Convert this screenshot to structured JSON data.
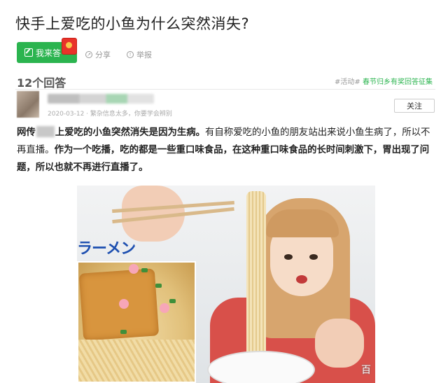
{
  "question": {
    "title": "快手上爱吃的小鱼为什么突然消失?"
  },
  "actions": {
    "answer_label": "我来答",
    "share_label": "分享",
    "report_label": "举报"
  },
  "answers": {
    "count_label": "12个回答",
    "tags": {
      "prefix": "#活动#",
      "highlight": "春节归乡有奖回答征集"
    }
  },
  "answer": {
    "meta": "2020-03-12 · 繁杂信息太多，你要学会辨别",
    "follow_label": "关注",
    "text": {
      "p1": "网传",
      "p2": "上爱吃的小鱼突然消失是因为生病。",
      "p3": "有自称爱吃的小鱼的朋友站出来说小鱼生病了，所以不再直播。",
      "p4": "作为一个吃播，吃的都是一些重口味食品，在这种重口味食品的长时间刺激下，胃出现了问题，所以也就不再进行直播了。"
    },
    "image": {
      "sign_text": "ラーメン",
      "watermark": "百"
    }
  },
  "colors": {
    "accent": "#2bb44f",
    "red_packet": "#e8332a"
  },
  "icons": [
    "pen-icon",
    "red-packet-icon",
    "share-icon",
    "report-icon"
  ]
}
